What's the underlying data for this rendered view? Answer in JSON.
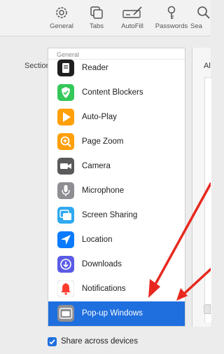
{
  "toolbar": {
    "items": [
      {
        "label": "General",
        "icon": "gear-icon"
      },
      {
        "label": "Tabs",
        "icon": "tabs-icon"
      },
      {
        "label": "AutoFill",
        "icon": "autofill-icon"
      },
      {
        "label": "Passwords",
        "icon": "key-icon"
      },
      {
        "label": "Sea",
        "icon": "search-icon"
      }
    ]
  },
  "sidebar": {
    "section_label": "Section"
  },
  "list": {
    "header": "General",
    "items": [
      {
        "label": "Reader",
        "icon": "reader-icon",
        "color": "#1f1f1f"
      },
      {
        "label": "Content Blockers",
        "icon": "checkmark-shield-icon",
        "color": "#34c759"
      },
      {
        "label": "Auto-Play",
        "icon": "play-icon",
        "color": "#ff9f0a"
      },
      {
        "label": "Page Zoom",
        "icon": "zoom-icon",
        "color": "#ff9f0a"
      },
      {
        "label": "Camera",
        "icon": "camera-icon",
        "color": "#5a5a5a"
      },
      {
        "label": "Microphone",
        "icon": "microphone-icon",
        "color": "#8e8e93"
      },
      {
        "label": "Screen Sharing",
        "icon": "screen-sharing-icon",
        "color": "#2fa9f0"
      },
      {
        "label": "Location",
        "icon": "location-arrow-icon",
        "color": "#0a7aff"
      },
      {
        "label": "Downloads",
        "icon": "download-icon",
        "color": "#5b5be6"
      },
      {
        "label": "Notifications",
        "icon": "bell-icon",
        "color": "#ff3b30"
      },
      {
        "label": "Pop-up Windows",
        "icon": "popup-window-icon",
        "color": "#8e8e93",
        "selected": true
      }
    ]
  },
  "right_panel": {
    "text": "Al"
  },
  "footer": {
    "checkbox_label": "Share across devices",
    "checked": true
  },
  "colors": {
    "selection": "#1f6fde",
    "arrow": "#e8281e"
  }
}
